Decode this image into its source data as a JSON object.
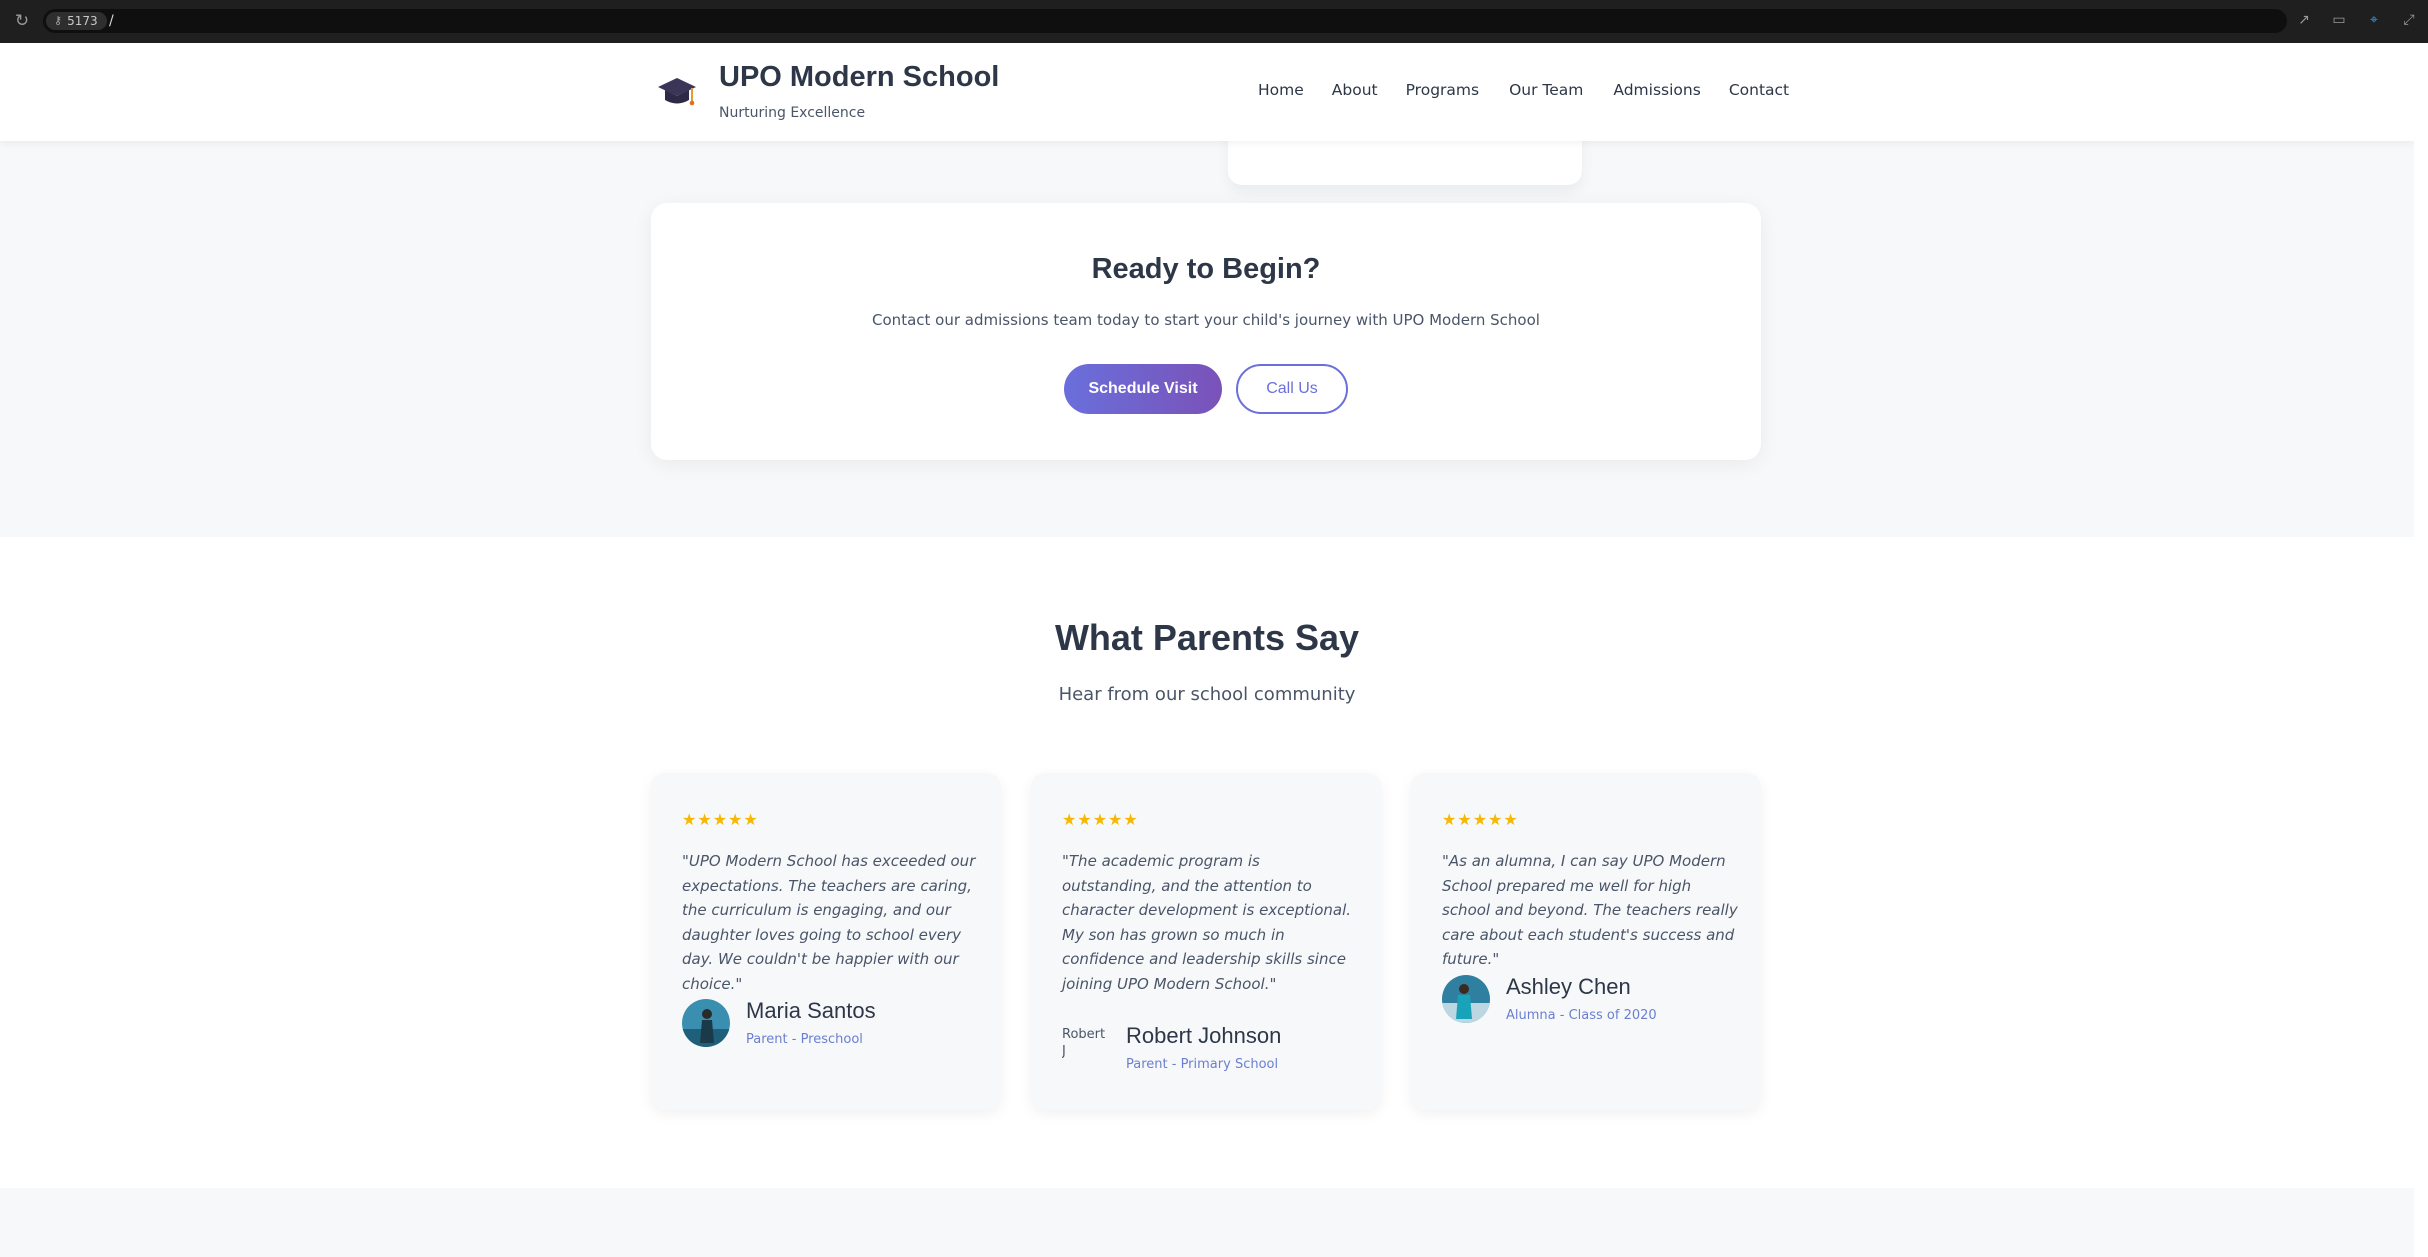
{
  "browser": {
    "port": "5173",
    "path": "/"
  },
  "header": {
    "brand_name": "UPO Modern School",
    "tagline": "Nurturing Excellence",
    "nav": [
      "Home",
      "About",
      "Programs",
      "Our Team",
      "Admissions",
      "Contact"
    ]
  },
  "cta": {
    "title": "Ready to Begin?",
    "text": "Contact our admissions team today to start your child's journey with UPO Modern School",
    "primary_button": "Schedule Visit",
    "secondary_button": "Call Us"
  },
  "testimonials": {
    "title": "What Parents Say",
    "subtitle": "Hear from our school community",
    "items": [
      {
        "stars": "★★★★★",
        "quote": "\"UPO Modern School has exceeded our expectations. The teachers are caring, the curriculum is engaging, and our daughter loves going to school every day. We couldn't be happier with our choice.\"",
        "name": "Maria Santos",
        "role": "Parent - Preschool"
      },
      {
        "stars": "★★★★★",
        "quote": "\"The academic program is outstanding, and the attention to character development is exceptional. My son has grown so much in confidence and leadership skills since joining UPO Modern School.\"",
        "name": "Robert Johnson",
        "role": "Parent - Primary School",
        "avatar_alt": "Robert J"
      },
      {
        "stars": "★★★★★",
        "quote": "\"As an alumna, I can say UPO Modern School prepared me well for high school and beyond. The teachers really care about each student's success and future.\"",
        "name": "Ashley Chen",
        "role": "Alumna - Class of 2020"
      }
    ]
  },
  "colors": {
    "accent": "#6a6fdc",
    "accent_dark": "#7a52b8",
    "star": "#f6b800",
    "text": "#2d3748"
  }
}
